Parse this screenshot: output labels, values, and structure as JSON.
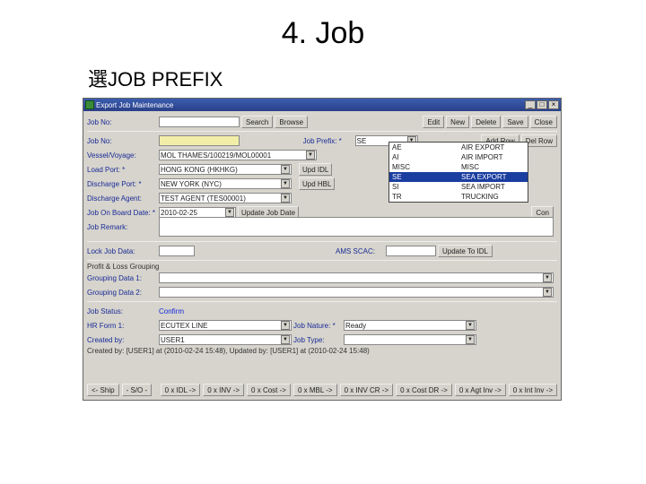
{
  "slide": {
    "title": "4. Job",
    "subtitle": "選JOB PREFIX"
  },
  "window": {
    "title": "Export Job Maintenance"
  },
  "toolbar1": {
    "job_no_lbl": "Job No:",
    "search": "Search",
    "browse": "Browse",
    "edit": "Edit",
    "new": "New",
    "delete": "Delete",
    "save": "Save",
    "close": "Close"
  },
  "toolbar2": {
    "job_no_lbl": "Job No:",
    "job_prefix_lbl": "Job Prefix: *",
    "job_prefix_val": "SE",
    "add_row": "Add Row",
    "del_row": "Del Row"
  },
  "fields": {
    "vessel_lbl": "Vessel/Voyage:",
    "vessel_val": "MOL THAMES/100219/MOL00001",
    "load_lbl": "Load Port: *",
    "load_val": "HONG KONG  (HKHKG)",
    "disch_lbl": "Discharge Port: *",
    "disch_val": "NEW YORK  (NYC)",
    "agent_lbl": "Discharge Agent:",
    "agent_val": "TEST AGENT  (TES00001)",
    "obd_lbl": "Job On Board Date: *",
    "obd_val": "2010-02-25",
    "remark_lbl": "Job Remark:",
    "upd_idl": "Upd IDL",
    "upd_hbl": "Upd HBL",
    "update_job": "Update Job Date",
    "con_btn": "Con"
  },
  "dropdown": {
    "c1": "AE",
    "d1": "AIR EXPORT",
    "c2": "AI",
    "d2": "AIR IMPORT",
    "c3": "MISC",
    "d3": "MISC",
    "c4": "SE",
    "d4": "SEA EXPORT",
    "c5": "SI",
    "d5": "SEA IMPORT",
    "c6": "TR",
    "d6": "TRUCKING"
  },
  "lock": {
    "lbl": "Lock Job Data:",
    "ams": "AMS SCAC:",
    "upd_idl": "Update To IDL"
  },
  "group": {
    "pl": "Profit & Loss Grouping",
    "g1": "Grouping Data 1:",
    "g2": "Grouping Data 2:"
  },
  "status": {
    "jobstat": "Job Status:",
    "confirm": "Confirm",
    "hrform": "HR Form 1:",
    "created_lbl": "Created by:",
    "nature_lbl": "Job Nature: *",
    "nature_val": "Ready",
    "carrier_val": "ECUTEX LINE",
    "user_val": "USER1",
    "jobtype_lbl": "Job Type:",
    "audit": "Created by: [USER1] at (2010-02-24 15:48), Updated by: [USER1] at (2010-02-24 15:48)"
  },
  "btns": {
    "ship": "<- Ship",
    "so": "- S/O -",
    "idl": "0 x IDL ->",
    "inv": "0 x INV ->",
    "cost": "0 x Cost ->",
    "mbl": "0 x MBL ->",
    "invcr": "0 x INV CR ->",
    "costdr": "0 x Cost DR ->",
    "agt": "0 x Agt Inv ->",
    "intinv": "0 x Int Inv ->"
  }
}
